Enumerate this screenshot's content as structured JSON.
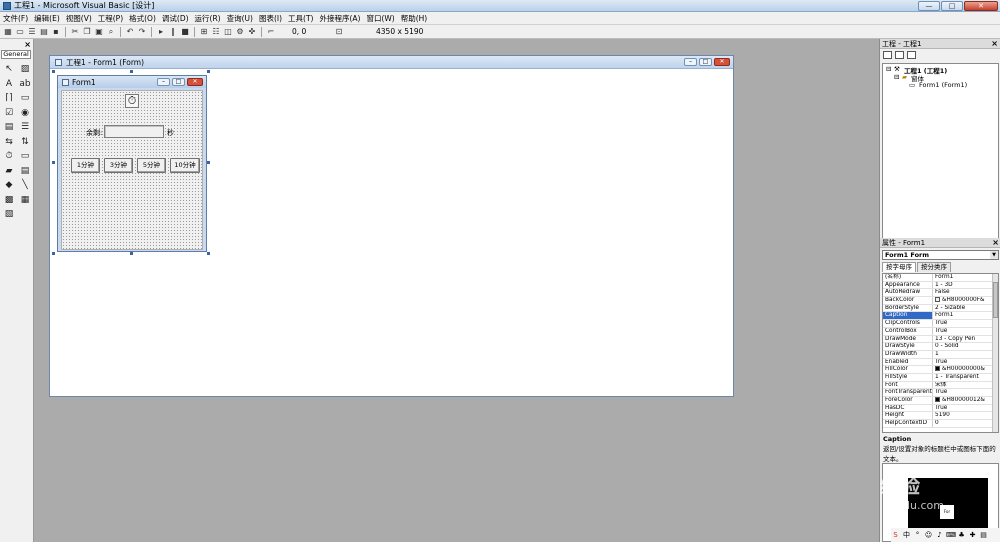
{
  "window": {
    "title": "工程1 - Microsoft Visual Basic [设计]",
    "min": "—",
    "max": "□",
    "close": "✕"
  },
  "menu": [
    "文件(F)",
    "编辑(E)",
    "视图(V)",
    "工程(P)",
    "格式(O)",
    "调试(D)",
    "运行(R)",
    "查询(U)",
    "图表(I)",
    "工具(T)",
    "外接程序(A)",
    "窗口(W)",
    "帮助(H)"
  ],
  "toolbar": {
    "position": "0, 0",
    "size": "4350 x 5190"
  },
  "toolbox": {
    "tab_label": "General",
    "close": "×"
  },
  "designer": {
    "title": "工程1 - Form1 (Form)"
  },
  "form1": {
    "title": "Form1",
    "timer_icon": "⏱",
    "remaining_label": "余剩:",
    "seconds_label": "秒",
    "buttons": [
      "1分钟",
      "3分钟",
      "5分钟",
      "10分钟"
    ]
  },
  "project": {
    "title": "工程 - 工程1",
    "close": "×",
    "root": "工程1 (工程1)",
    "folder": "窗体",
    "form": "Form1 (Form1)"
  },
  "properties": {
    "title": "属性 - Form1",
    "close": "×",
    "object": "Form1 Form",
    "tabs": [
      "按字母序",
      "按分类序"
    ],
    "rows": [
      {
        "name": "(名称)",
        "value": "Form1"
      },
      {
        "name": "Appearance",
        "value": "1 - 3D"
      },
      {
        "name": "AutoRedraw",
        "value": "False"
      },
      {
        "name": "BackColor",
        "value": "&H8000000F&",
        "swatch": "#f0f0f0"
      },
      {
        "name": "BorderStyle",
        "value": "2 - Sizable"
      },
      {
        "name": "Caption",
        "value": "Form1",
        "selected": true
      },
      {
        "name": "ClipControls",
        "value": "True"
      },
      {
        "name": "ControlBox",
        "value": "True"
      },
      {
        "name": "DrawMode",
        "value": "13 - Copy Pen"
      },
      {
        "name": "DrawStyle",
        "value": "0 - Solid"
      },
      {
        "name": "DrawWidth",
        "value": "1"
      },
      {
        "name": "Enabled",
        "value": "True"
      },
      {
        "name": "FillColor",
        "value": "&H00000000&",
        "swatch": "#000000"
      },
      {
        "name": "FillStyle",
        "value": "1 - Transparent"
      },
      {
        "name": "Font",
        "value": "宋体"
      },
      {
        "name": "FontTransparent",
        "value": "True"
      },
      {
        "name": "ForeColor",
        "value": "&H80000012&",
        "swatch": "#000000"
      },
      {
        "name": "HasDC",
        "value": "True"
      },
      {
        "name": "Height",
        "value": "5190"
      },
      {
        "name": "HelpContextID",
        "value": "0"
      }
    ],
    "desc_name": "Caption",
    "desc_text": "返回/设置对象的标题栏中或图标下面的文本。"
  },
  "watermark": {
    "text": "经验",
    "sub": "du.com"
  },
  "colors": {
    "titlebar": "#b9d1ea",
    "selection": "#3169c6",
    "mdi": "#ababab"
  }
}
